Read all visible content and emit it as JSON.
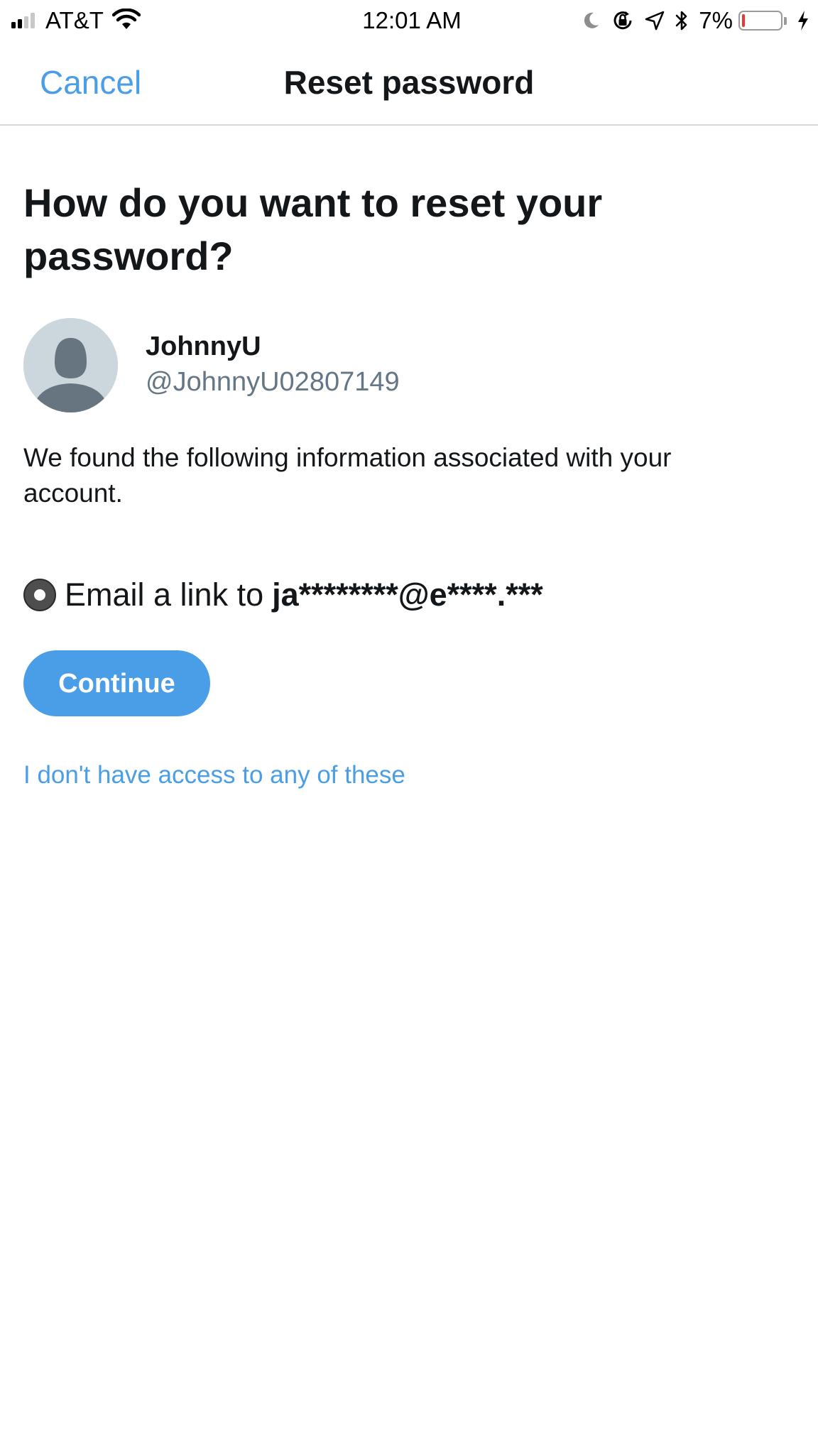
{
  "status_bar": {
    "carrier": "AT&T",
    "time": "12:01 AM",
    "battery_percent": "7%",
    "battery_level": 0.07,
    "signal_bars_filled": 2,
    "signal_bars_total": 4,
    "icons": [
      "signal-icon",
      "wifi-icon",
      "moon-icon",
      "orientation-lock-icon",
      "location-icon",
      "bluetooth-icon",
      "battery-icon",
      "charging-bolt-icon"
    ]
  },
  "nav": {
    "cancel_label": "Cancel",
    "title": "Reset password"
  },
  "main": {
    "heading": "How do you want to reset your password?",
    "account": {
      "name": "JohnnyU",
      "handle": "@JohnnyU02807149",
      "avatar_icon": "default-avatar-icon"
    },
    "info_text": "We found the following information associated with your account.",
    "option": {
      "label": "Email a link to",
      "email": "ja********@e****.***",
      "selected": true
    },
    "continue_label": "Continue",
    "no_access_link": "I don't have access to any of these"
  },
  "colors": {
    "accent": "#4a9ee8",
    "text": "#14171a",
    "secondary_text": "#657786",
    "avatar_bg": "#ccd6dd",
    "battery_low": "#e53935"
  }
}
